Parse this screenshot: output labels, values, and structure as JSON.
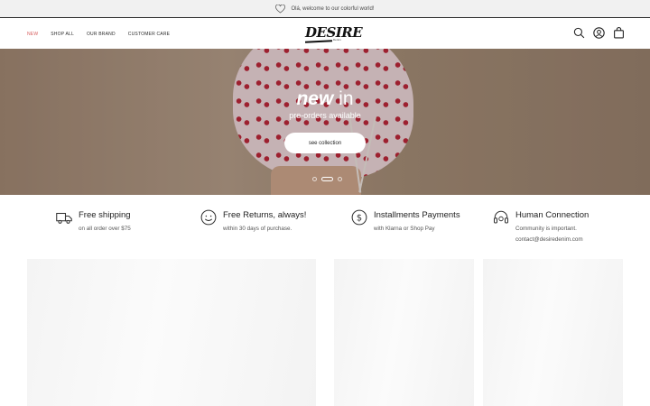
{
  "announcement": {
    "text": "Olá, welcome to our colorful world!",
    "icon": "heart-icon"
  },
  "header": {
    "nav": [
      {
        "label": "NEW",
        "active": true
      },
      {
        "label": "SHOP ALL"
      },
      {
        "label": "OUR BRAND"
      },
      {
        "label": "CUSTOMER CARE"
      }
    ],
    "logo": {
      "text": "DESIRE",
      "sub": "Denim"
    },
    "icons": [
      "search-icon",
      "account-icon",
      "cart-icon"
    ]
  },
  "hero": {
    "title_em": "new",
    "title_rest": " in",
    "subtitle": "pre-orders available",
    "button": "see collection",
    "slides": 3,
    "active_slide": 1
  },
  "features": [
    {
      "icon": "truck-icon",
      "title": "Free shipping",
      "subtitle": "on all order over $75"
    },
    {
      "icon": "smile-icon",
      "title": "Free Returns, always!",
      "subtitle": "within 30 days of purchase."
    },
    {
      "icon": "dollar-icon",
      "title": "Installments Payments",
      "subtitle": "with Klarna or Shop Pay"
    },
    {
      "icon": "headset-icon",
      "title": "Human Connection",
      "subtitle": "Community is important.",
      "subtitle2": "contact@desiredenim.com"
    }
  ],
  "colors": {
    "accent": "#d65b5b",
    "text": "#2b2b2b",
    "announce_bg": "#f1f1f1"
  }
}
